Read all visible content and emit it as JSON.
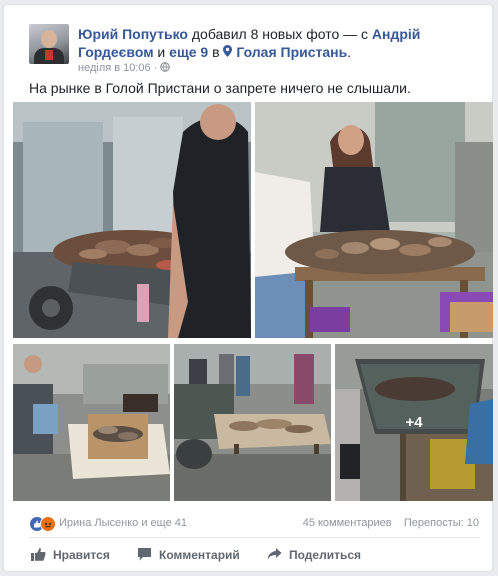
{
  "post": {
    "author": "Юрий Попутько",
    "action": " добавил 8 новых фото — с ",
    "with1": "Андрій Гордеєвом",
    "and_text": " и ",
    "others": "еще 9",
    "in_text": " в ",
    "location": "Голая Пристань",
    "period": ".",
    "timestamp": "неділя в 10:06",
    "sep": " · ",
    "text": "На рынке в Голой Пристани о запрете ничего не слышали.",
    "more_photos": "+4"
  },
  "reactions": {
    "names": "Ирина Лысенко и еще 41",
    "comments": "45 комментариев",
    "shares": "Перепосты: 10",
    "like_color": "#3b5998",
    "angry_color": "#e9710f"
  },
  "actions": {
    "like": "Нравится",
    "comment": "Комментарий",
    "share": "Поделиться"
  },
  "icons": [
    "globe-icon",
    "location-pin-icon",
    "like-icon",
    "angry-icon",
    "thumbs-up-icon",
    "comment-icon",
    "share-icon"
  ]
}
